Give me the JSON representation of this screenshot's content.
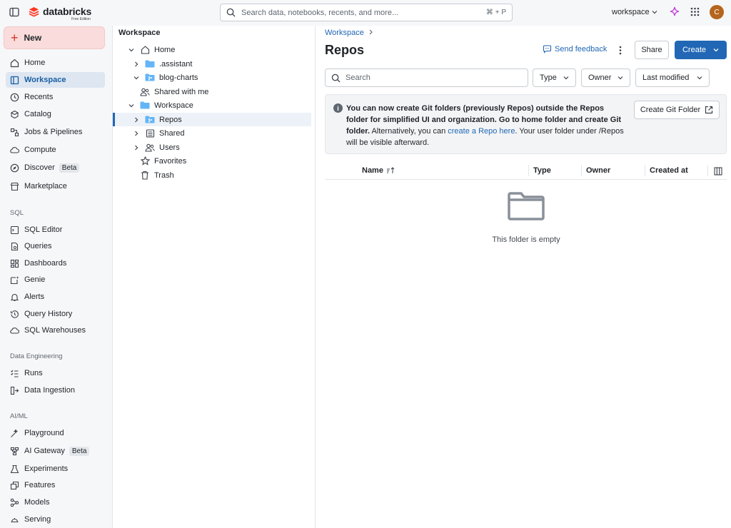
{
  "header": {
    "logo_text": "databricks",
    "logo_sub": "Free Edition",
    "search_placeholder": "Search data, notebooks, recents, and more...",
    "search_shortcut": "⌘ + P",
    "workspace_switcher": "workspace",
    "avatar_initial": "C"
  },
  "sidebar": {
    "new_label": "New",
    "items": [
      {
        "label": "Home",
        "icon": "home-icon"
      },
      {
        "label": "Workspace",
        "icon": "workspace-icon",
        "active": true
      },
      {
        "label": "Recents",
        "icon": "clock-icon"
      },
      {
        "label": "Catalog",
        "icon": "catalog-icon"
      },
      {
        "label": "Jobs & Pipelines",
        "icon": "jobs-icon"
      },
      {
        "label": "Compute",
        "icon": "cloud-icon"
      },
      {
        "label": "Discover",
        "icon": "compass-icon",
        "badge": "Beta"
      },
      {
        "label": "Marketplace",
        "icon": "store-icon"
      }
    ],
    "sql_section": "SQL",
    "sql_items": [
      {
        "label": "SQL Editor"
      },
      {
        "label": "Queries"
      },
      {
        "label": "Dashboards"
      },
      {
        "label": "Genie"
      },
      {
        "label": "Alerts"
      },
      {
        "label": "Query History"
      },
      {
        "label": "SQL Warehouses"
      }
    ],
    "de_section": "Data Engineering",
    "de_items": [
      {
        "label": "Runs"
      },
      {
        "label": "Data Ingestion"
      }
    ],
    "ml_section": "AI/ML",
    "ml_items": [
      {
        "label": "Playground"
      },
      {
        "label": "AI Gateway",
        "badge": "Beta"
      },
      {
        "label": "Experiments"
      },
      {
        "label": "Features"
      },
      {
        "label": "Models"
      },
      {
        "label": "Serving"
      }
    ]
  },
  "tree": {
    "title": "Workspace",
    "rows": [
      {
        "label": "Home"
      },
      {
        "label": ".assistant"
      },
      {
        "label": "blog-charts"
      },
      {
        "label": "Shared with me"
      },
      {
        "label": "Workspace"
      },
      {
        "label": "Repos"
      },
      {
        "label": "Shared"
      },
      {
        "label": "Users"
      },
      {
        "label": "Favorites"
      },
      {
        "label": "Trash"
      }
    ]
  },
  "main": {
    "breadcrumb": "Workspace",
    "title": "Repos",
    "feedback": "Send feedback",
    "share": "Share",
    "create": "Create",
    "search_placeholder": "Search",
    "filters": {
      "type": "Type",
      "owner": "Owner",
      "modified": "Last modified"
    },
    "banner": {
      "bold": "You can now create Git folders (previously Repos) outside the Repos folder for simplified UI and organization. Go to home folder and create Git folder.",
      "pre": " Alternatively, you can ",
      "link": "create a Repo here",
      "post": ". Your user folder under /Repos will be visible afterward.",
      "button": "Create Git Folder"
    },
    "columns": {
      "name": "Name",
      "type": "Type",
      "owner": "Owner",
      "created": "Created at"
    },
    "empty_text": "This folder is empty"
  },
  "colors": {
    "accent": "#2167b5",
    "brand": "#ff3621",
    "avatar": "#b5651d"
  }
}
